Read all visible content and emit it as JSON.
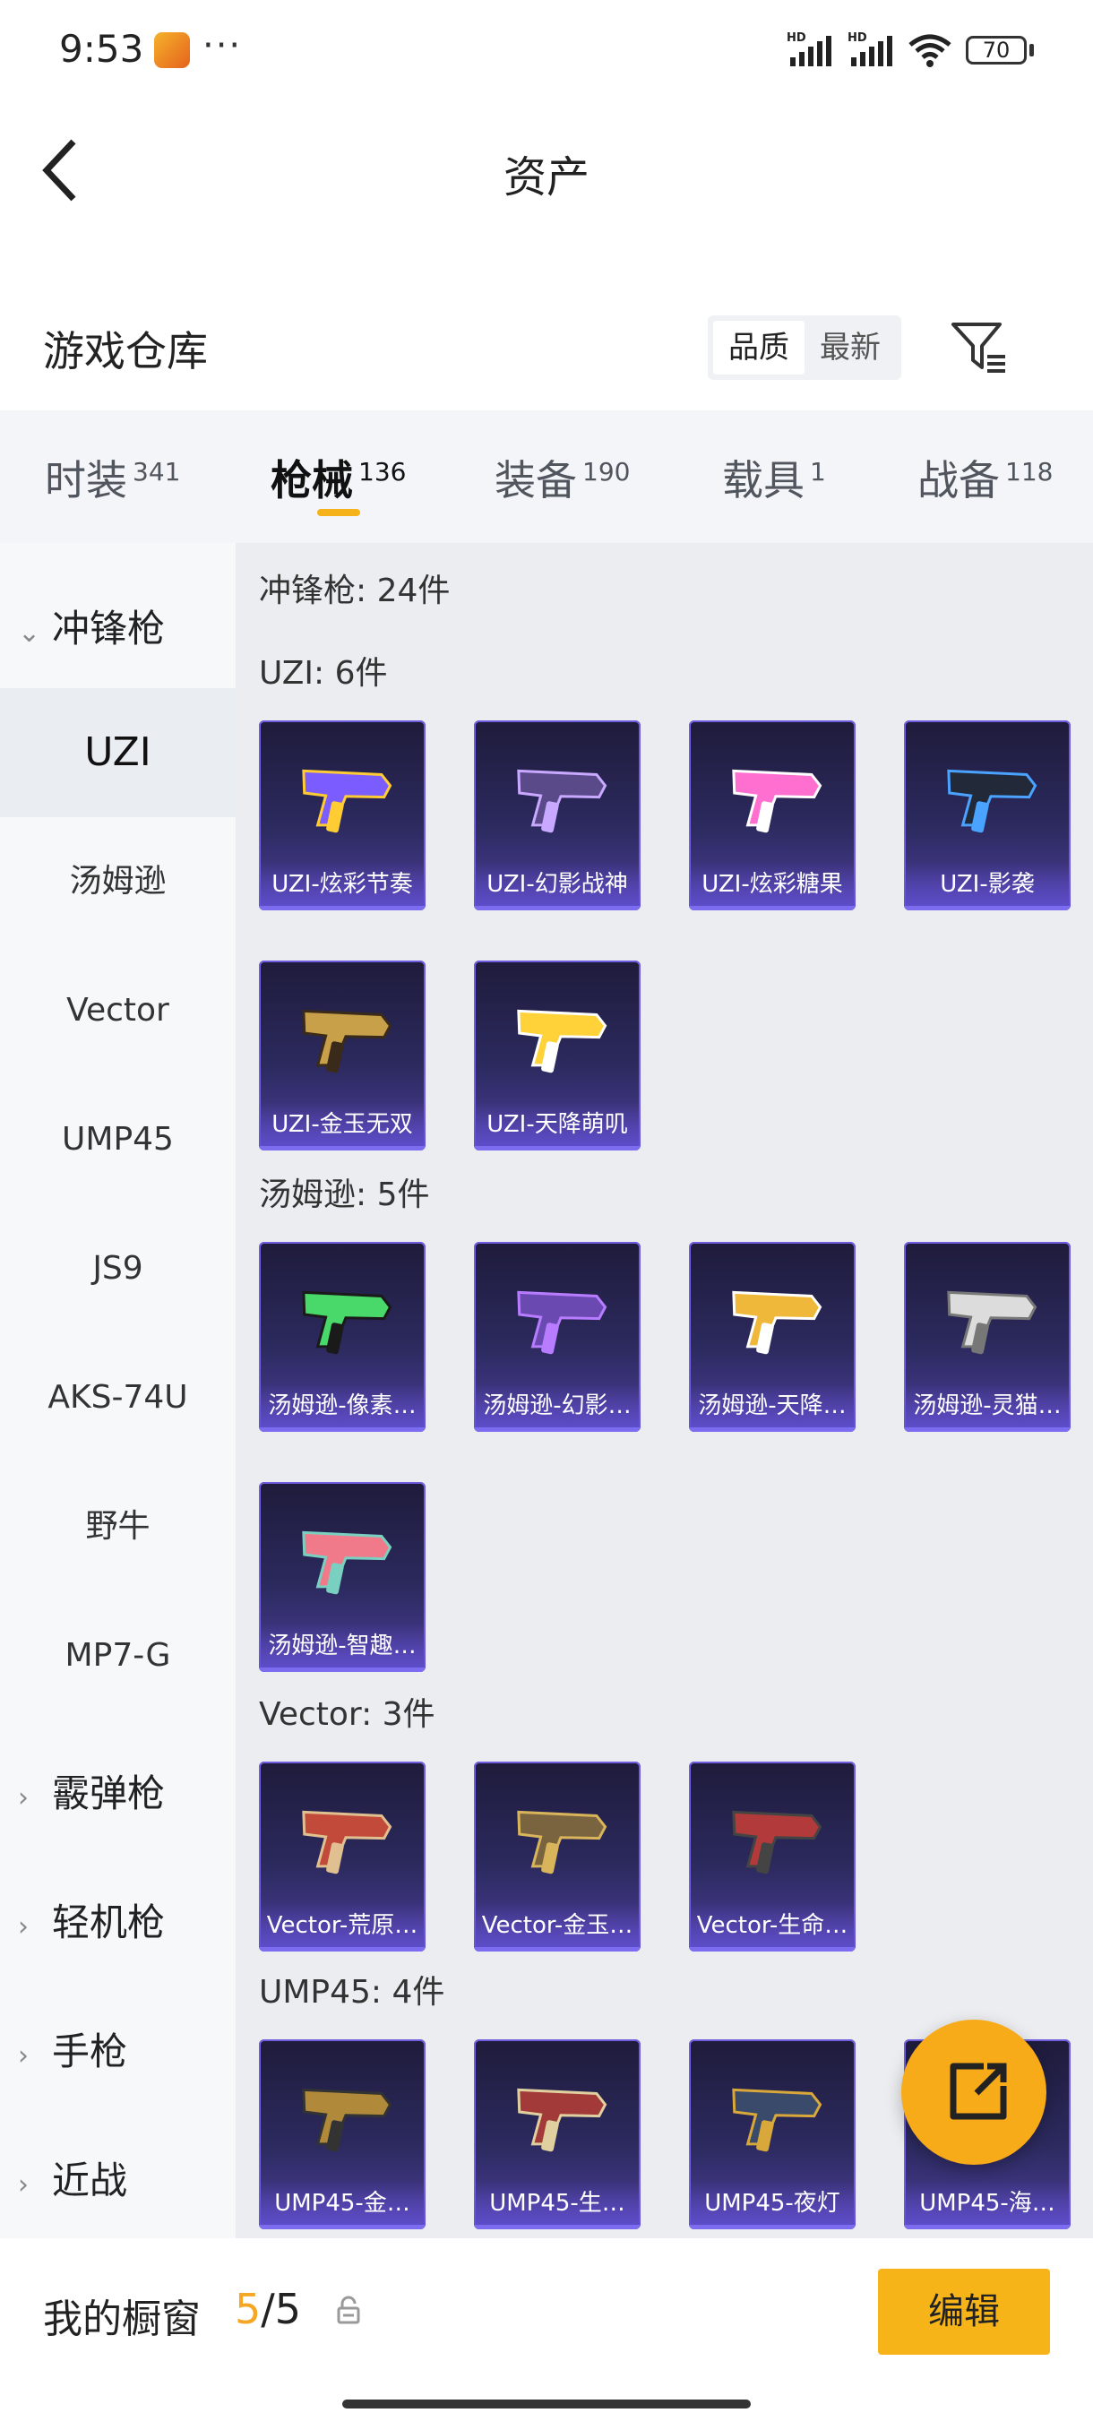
{
  "status": {
    "time": "9:53",
    "more": "···",
    "battery": "70",
    "net1": "HD",
    "net2": "HD"
  },
  "header": {
    "title": "资产"
  },
  "warehouse": {
    "title": "游戏仓库",
    "sort_quality": "品质",
    "sort_newest": "最新"
  },
  "tabs": [
    {
      "label": "时装",
      "count": "341"
    },
    {
      "label": "枪械",
      "count": "136"
    },
    {
      "label": "装备",
      "count": "190"
    },
    {
      "label": "载具",
      "count": "1"
    },
    {
      "label": "战备",
      "count": "118"
    }
  ],
  "sidebar": {
    "expanded": "冲锋枪",
    "subs": [
      "UZI",
      "汤姆逊",
      "Vector",
      "UMP45",
      "JS9",
      "AKS-74U",
      "野牛",
      "MP7-G"
    ],
    "collapsed": [
      "霰弹枪",
      "轻机枪",
      "手枪",
      "近战"
    ]
  },
  "main": {
    "total": "冲锋枪: 24件",
    "groups": [
      {
        "label": "UZI: 6件",
        "items": [
          "UZI-炫彩节奏",
          "UZI-幻影战神",
          "UZI-炫彩糖果",
          "UZI-影袭",
          "UZI-金玉无双",
          "UZI-天降萌叽"
        ]
      },
      {
        "label": "汤姆逊: 5件",
        "items": [
          "汤姆逊-像素…",
          "汤姆逊-幻影…",
          "汤姆逊-天降…",
          "汤姆逊-灵猫…",
          "汤姆逊-智趣…"
        ]
      },
      {
        "label": "Vector: 3件",
        "items": [
          "Vector-荒原…",
          "Vector-金玉…",
          "Vector-生命…"
        ]
      },
      {
        "label": "UMP45: 4件",
        "items": [
          "UMP45-金…",
          "UMP45-生…",
          "UMP45-夜灯",
          "UMP45-海…"
        ]
      }
    ]
  },
  "bottom": {
    "label": "我的橱窗",
    "current": "5",
    "sep": "/",
    "max": "5",
    "edit": "编辑"
  },
  "colors": {
    "accent": "#f7b418",
    "card_bg": "#2c2a5e",
    "card_border": "#6f5fe0"
  },
  "icons": [
    "back-icon",
    "filter-icon",
    "lock-icon",
    "share-icon",
    "wifi-icon",
    "signal-icon",
    "battery-icon"
  ]
}
